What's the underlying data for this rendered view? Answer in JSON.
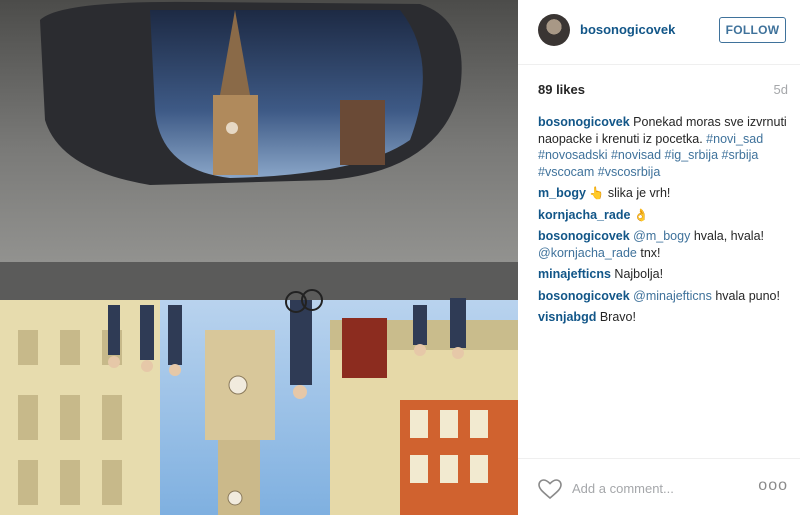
{
  "post": {
    "author": "bosonogicovek",
    "follow_label": "FOLLOW",
    "likes": "89 likes",
    "age": "5d"
  },
  "caption": {
    "user": "bosonogicovek",
    "text": "Ponekad moras sve izvrnuti naopacke i krenuti iz pocetka.",
    "tags": [
      "#novi_sad",
      "#novosadski",
      "#novisad",
      "#ig_srbija",
      "#srbija",
      "#vscocam",
      "#vscosrbija"
    ]
  },
  "comments": [
    {
      "user": "m_bogy",
      "emoji": "👆",
      "text": "slika je vrh!"
    },
    {
      "user": "kornjacha_rade",
      "emoji": "👌"
    },
    {
      "user": "bosonogicovek",
      "mention1": "@m_bogy",
      "text1": "hvala, hvala!",
      "mention2": "@kornjacha_rade",
      "text2": "tnx!"
    },
    {
      "user": "minajefticns",
      "text": "Najbolja!"
    },
    {
      "user": "bosonogicovek",
      "mention1": "@minajefticns",
      "text1": "hvala puno!"
    },
    {
      "user": "visnjabgd",
      "text": "Bravo!"
    }
  ],
  "footer": {
    "placeholder": "Add a comment...",
    "more": "ooo"
  }
}
